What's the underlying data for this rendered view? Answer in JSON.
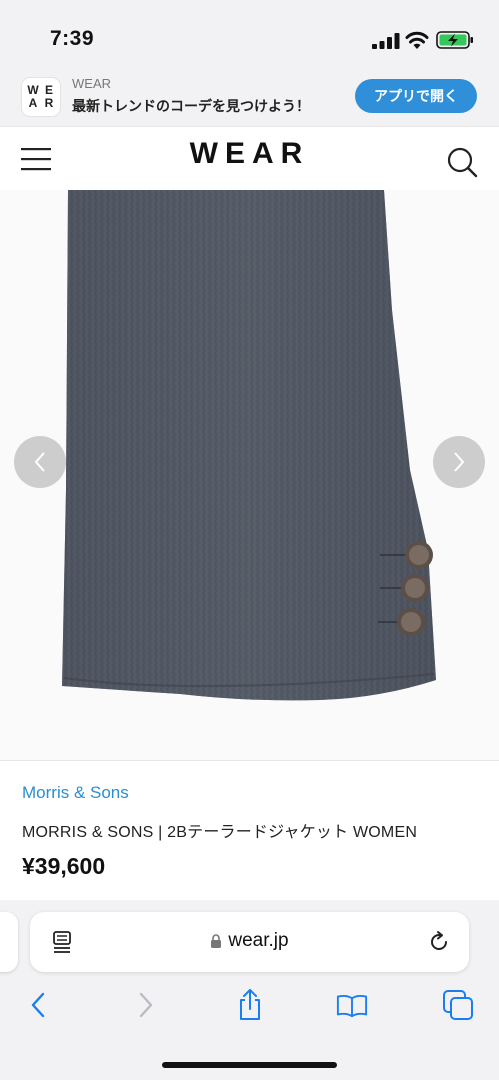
{
  "status_bar": {
    "time": "7:39"
  },
  "app_banner": {
    "icon_letters": [
      "W",
      "E",
      "A",
      "R"
    ],
    "app_name": "WEAR",
    "tagline": "最新トレンドのコーデを見つけよう！",
    "open_label": "アプリで開く"
  },
  "header": {
    "logo": "WEAR"
  },
  "product": {
    "brand": "Morris & Sons",
    "name": "MORRIS & SONS | 2Bテーラードジャケット WOMEN",
    "price": "¥39,600"
  },
  "browser": {
    "url": "wear.jp"
  },
  "colors": {
    "accent": "#2f8fd8",
    "brand_link": "#2b8ed0",
    "ios_blue": "#1a7ef2",
    "fabric": "#535a66"
  }
}
